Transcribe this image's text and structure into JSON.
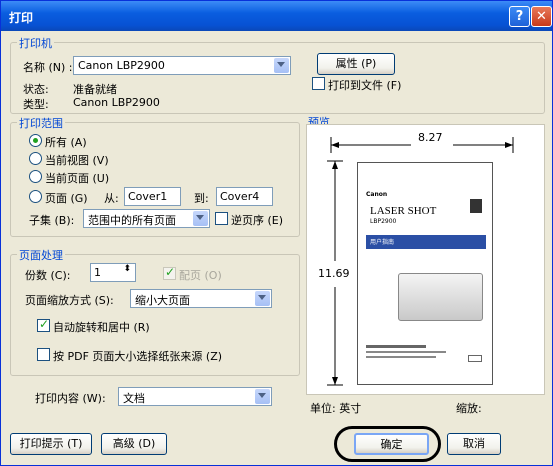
{
  "window": {
    "title": "打印",
    "help_icon": "?",
    "close_icon": "✕"
  },
  "printer": {
    "group_label": "打印机",
    "name_label": "名称 (N) :",
    "name_value": "Canon LBP2900",
    "properties_button": "属性 (P)",
    "status_label": "状态:",
    "status_value": "准备就绪",
    "type_label": "类型:",
    "type_value": "Canon LBP2900",
    "print_to_file_label": "打印到文件 (F)",
    "print_to_file_checked": false
  },
  "range": {
    "group_label": "打印范围",
    "all_label": "所有 (A)",
    "current_view_label": "当前视图 (V)",
    "current_page_label": "当前页面 (U)",
    "pages_label": "页面 (G)",
    "from_label": "从:",
    "from_value": "Cover1",
    "to_label": "到:",
    "to_value": "Cover4",
    "selected": "all",
    "subset_label": "子集 (B):",
    "subset_value": "范围中的所有页面",
    "reverse_label": "逆页序 (E)",
    "reverse_checked": false
  },
  "handling": {
    "group_label": "页面处理",
    "copies_label": "份数 (C):",
    "copies_value": "1",
    "collate_label": "配页 (O)",
    "collate_checked": true,
    "scaling_label": "页面缩放方式 (S):",
    "scaling_value": "缩小大页面",
    "autorotate_label": "自动旋转和居中 (R)",
    "autorotate_checked": true,
    "pdf_size_label": "按 PDF 页面大小选择纸张来源 (Z)",
    "pdf_size_checked": false
  },
  "content": {
    "label": "打印内容 (W):",
    "value": "文档"
  },
  "preview": {
    "group_label": "预览",
    "width": "8.27",
    "height": "11.69",
    "unit_label": "单位: 英寸",
    "zoom_label": "缩放:",
    "doc_brand": "Canon",
    "doc_title": "LASER SHOT",
    "doc_model": "LBP2900",
    "doc_banner": "用户指南"
  },
  "footer": {
    "tips_button": "打印提示 (T)",
    "advanced_button": "高级 (D)",
    "ok_button": "确定",
    "cancel_button": "取消"
  }
}
